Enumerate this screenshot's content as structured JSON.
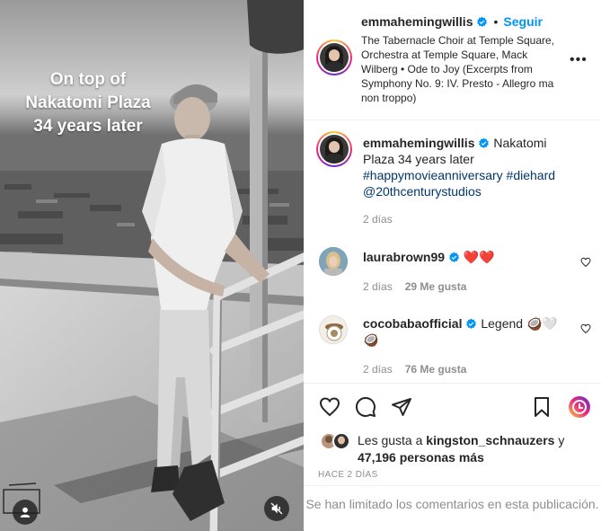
{
  "media": {
    "overlay_lines": [
      "On top of",
      "Nakatomi Plaza",
      "34 years later"
    ],
    "user_button_icon": "user-icon",
    "mute_button_icon": "muted-speaker-icon"
  },
  "header": {
    "username": "emmahemingwillis",
    "separator": "•",
    "follow_label": "Seguir",
    "song": "The Tabernacle Choir at Temple Square, Orchestra at Temple Square, Mack Wilberg • Ode to Joy (Excerpts from Symphony No. 9: IV. Presto - Allegro ma non troppo)",
    "more_label": "•••"
  },
  "caption": {
    "username": "emmahemingwillis",
    "text": "Nakatomi Plaza 34 years later",
    "hashtags": "#happymovieanniversary #diehard",
    "mention": "@20thcenturystudios",
    "time": "2 días"
  },
  "comments": [
    {
      "username": "laurabrown99",
      "text": "❤️❤️",
      "time": "2 días",
      "likes": "29 Me gusta"
    },
    {
      "username": "cocobabaofficial",
      "text": "Legend 🥥🤍",
      "text_line2": "🥥",
      "time": "2 días",
      "likes": "76 Me gusta"
    }
  ],
  "likes": {
    "prefix": "Les gusta a",
    "user": "kingston_schnauzers",
    "joiner": "y",
    "count": "47,196 personas más"
  },
  "date": "HACE 2 DÍAS",
  "limited": "Se han limitado los comentarios en esta publicación.",
  "colors": {
    "accent": "#0095f6",
    "verified": "#0095f6",
    "muted_text": "#8e8e8e",
    "link": "#00376b"
  }
}
